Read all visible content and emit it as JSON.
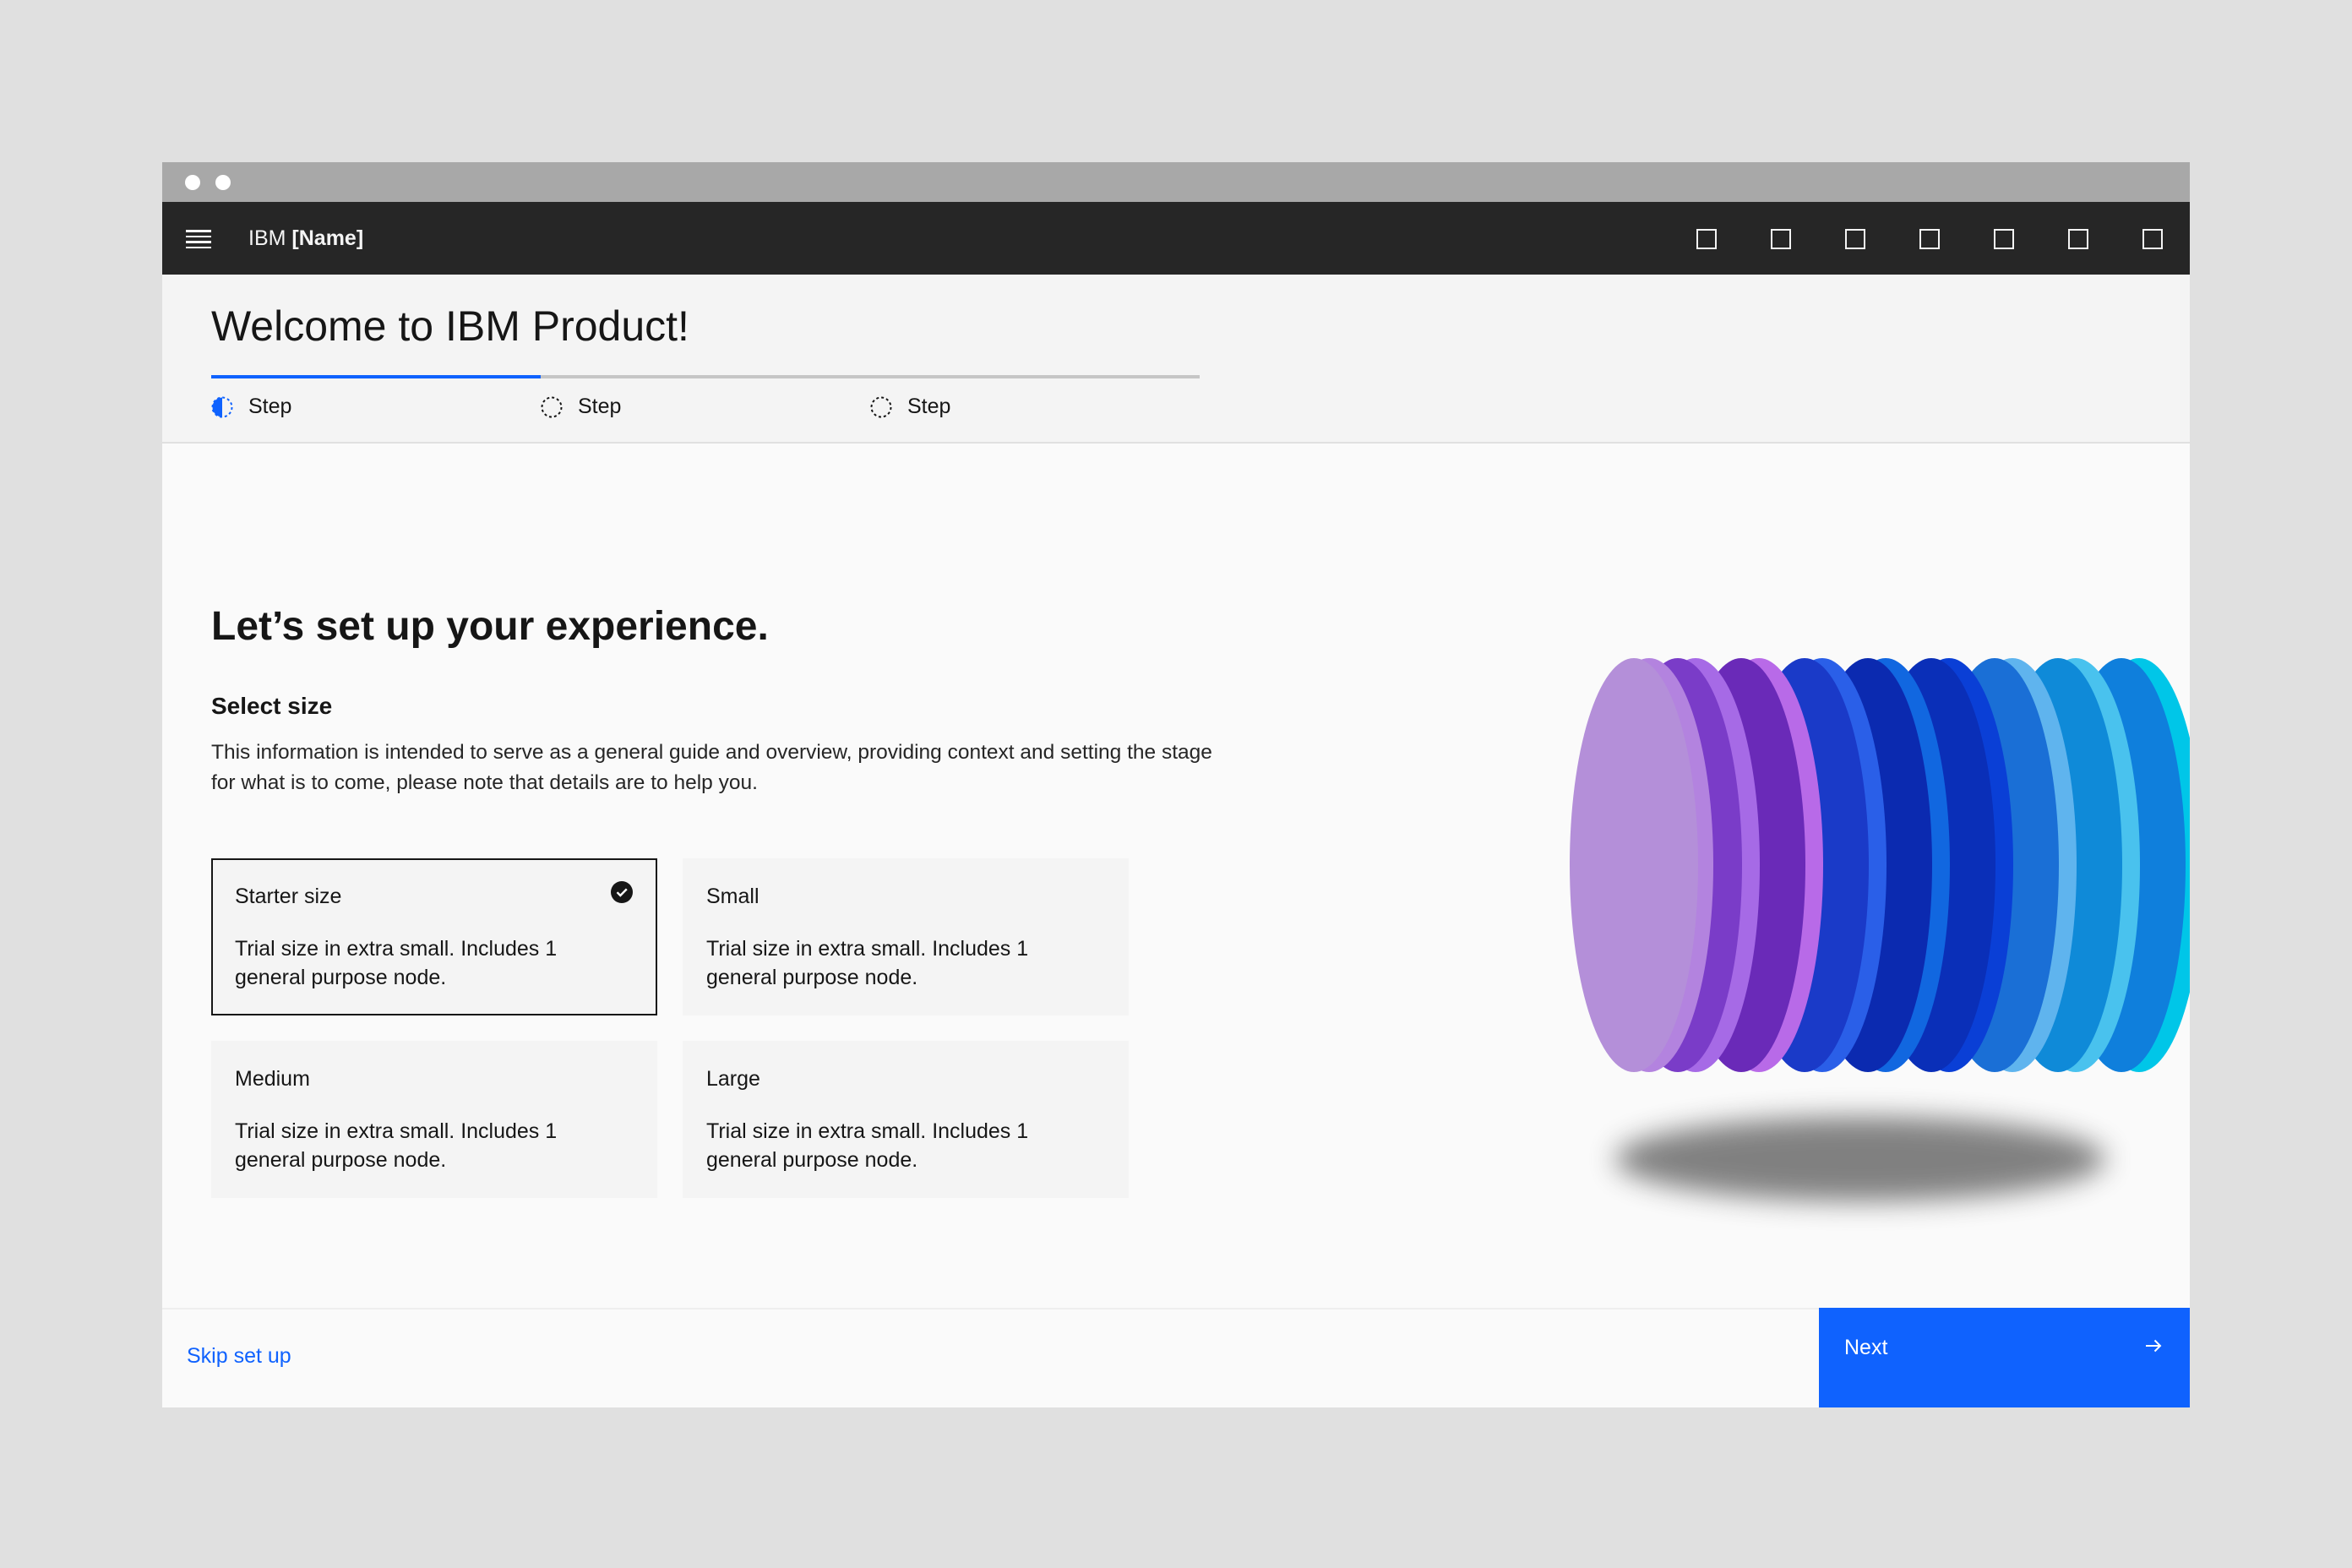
{
  "app": {
    "brand_prefix": "IBM",
    "brand_name": "[Name]",
    "header_icons": [
      "square-icon",
      "square-icon",
      "square-icon",
      "square-icon",
      "square-icon",
      "square-icon",
      "square-icon"
    ]
  },
  "onboarding": {
    "title": "Welcome to IBM Product!",
    "progress": {
      "current_step": 1,
      "total_steps": 3,
      "steps": [
        {
          "label": "Step",
          "state": "current"
        },
        {
          "label": "Step",
          "state": "incomplete"
        },
        {
          "label": "Step",
          "state": "incomplete"
        }
      ]
    }
  },
  "content": {
    "heading": "Let’s set up your experience.",
    "subheading": "Select size",
    "description": "This information is intended to serve as a general guide and overview, providing context and setting the stage for what is to come, please note that details are to help you.",
    "tiles": [
      {
        "title": "Starter size",
        "description": "Trial size in extra small. Includes 1 general purpose node.",
        "selected": true
      },
      {
        "title": "Small",
        "description": "Trial size in extra small. Includes 1 general purpose node.",
        "selected": false
      },
      {
        "title": "Medium",
        "description": "Trial size in extra small. Includes 1 general purpose node.",
        "selected": false
      },
      {
        "title": "Large",
        "description": "Trial size in extra small. Includes 1 general purpose node.",
        "selected": false
      }
    ]
  },
  "footer": {
    "skip_label": "Skip set up",
    "next_label": "Next"
  },
  "colors": {
    "accent": "#0f62fe",
    "header_bg": "#262626",
    "page_bg": "#fafafa",
    "tile_bg": "#f4f4f4"
  }
}
